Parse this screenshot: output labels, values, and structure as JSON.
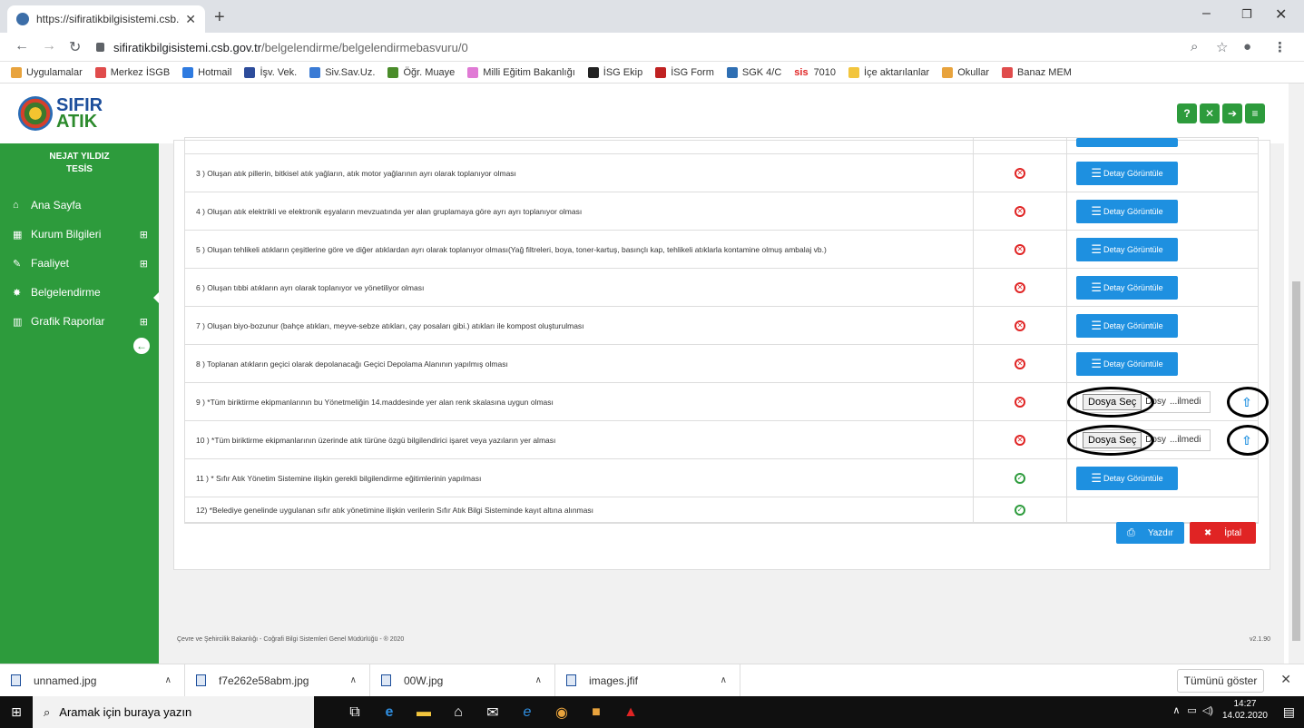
{
  "browser": {
    "tab_title": "https://sifiratikbilgisistemi.csb.go",
    "url_domain": "sifiratikbilgisistemi.csb.gov.tr",
    "url_path": "/belgelendirme/belgelendirmebasvuru/0",
    "bookmarks": [
      {
        "label": "Uygulamalar",
        "color": "#e8a33d"
      },
      {
        "label": "Merkez İSGB",
        "color": "#e04c4c"
      },
      {
        "label": "Hotmail",
        "color": "#2f7be0"
      },
      {
        "label": "İşv. Vek.",
        "color": "#2d4c9b"
      },
      {
        "label": "Siv.Sav.Uz.",
        "color": "#3a7bd5"
      },
      {
        "label": "Öğr. Muaye",
        "color": "#4a8c2a"
      },
      {
        "label": "Milli Eğitim Bakanlığı",
        "color": "#e07ad5"
      },
      {
        "label": "İSG Ekip",
        "color": "#222222"
      },
      {
        "label": "İSG Form",
        "color": "#c02222"
      },
      {
        "label": "SGK 4/C",
        "color": "#2f6fb3"
      },
      {
        "label": "7010",
        "color": "#e02424",
        "prefix": "sis"
      },
      {
        "label": "İçe aktarılanlar",
        "color": "#f2c53d"
      },
      {
        "label": "Okullar",
        "color": "#e8a33d"
      },
      {
        "label": "Banaz MEM",
        "color": "#e04c4c"
      }
    ]
  },
  "brand": {
    "line1": "SIFIR",
    "line2": "ATIK"
  },
  "sidebar": {
    "user_name": "NEJAT YILDIZ",
    "user_role": "TESİS",
    "items": [
      {
        "label": "Ana Sayfa",
        "icon": "home-icon",
        "glyph": "⌂",
        "expandable": false
      },
      {
        "label": "Kurum Bilgileri",
        "icon": "building-icon",
        "glyph": "▦",
        "expandable": true
      },
      {
        "label": "Faaliyet",
        "icon": "edit-icon",
        "glyph": "✎",
        "expandable": true
      },
      {
        "label": "Belgelendirme",
        "icon": "certificate-icon",
        "glyph": "✸",
        "expandable": false
      },
      {
        "label": "Grafik Raporlar",
        "icon": "bar-chart-icon",
        "glyph": "▥",
        "expandable": true
      }
    ]
  },
  "table": {
    "rows": [
      {
        "text": "",
        "status": "none",
        "action": "detail"
      },
      {
        "text": "3 ) Oluşan atık pillerin, bitkisel atık yağların, atık motor yağlarının ayrı olarak toplanıyor olması",
        "status": "fail",
        "action": "detail"
      },
      {
        "text": "4 ) Oluşan atık elektrikli ve elektronik eşyaların mevzuatında yer alan gruplamaya göre ayrı ayrı toplanıyor olması",
        "status": "fail",
        "action": "detail"
      },
      {
        "text": "5 ) Oluşan tehlikeli atıkların çeşitlerine göre ve diğer atıklardan ayrı olarak toplanıyor olması(Yağ filtreleri, boya, toner-kartuş, basınçlı kap, tehlikeli atıklarla kontamine olmuş ambalaj vb.)",
        "status": "fail",
        "action": "detail"
      },
      {
        "text": "6 ) Oluşan tıbbi atıkların ayrı olarak toplanıyor ve yönetiliyor olması",
        "status": "fail",
        "action": "detail"
      },
      {
        "text": "7 ) Oluşan biyo-bozunur (bahçe atıkları, meyve-sebze atıkları, çay posaları gibi.) atıkları ile kompost oluşturulması",
        "status": "fail",
        "action": "detail"
      },
      {
        "text": "8 ) Toplanan atıkların geçici olarak depolanacağı Geçici Depolama Alanının yapılmış olması",
        "status": "fail",
        "action": "detail"
      },
      {
        "text": "9 ) *Tüm biriktirme ekipmanlarının bu Yönetmeliğin 14.maddesinde yer alan renk skalasına uygun olması",
        "status": "fail",
        "action": "upload"
      },
      {
        "text": "10 ) *Tüm biriktirme ekipmanlarının üzerinde atık türüne özgü bilgilendirici işaret veya yazıların yer alması",
        "status": "fail",
        "action": "upload"
      },
      {
        "text": "11 ) * Sıfır Atık Yönetim Sistemine ilişkin gerekli bilgilendirme eğitimlerinin yapılması",
        "status": "ok",
        "action": "detail"
      },
      {
        "text": "12) *Belediye genelinde uygulanan sıfır atık yönetimine ilişkin verilerin Sıfır Atık Bilgi Sisteminde kayıt altına alınması",
        "status": "ok",
        "action": "none"
      }
    ],
    "detail_label": "Detay Görüntüle",
    "file_button": "Dosya Seç",
    "file_text_a": "Dosy",
    "file_text_b": "...ilmedi"
  },
  "actions": {
    "print": "Yazdır",
    "cancel": "İptal"
  },
  "footer": {
    "text": "Çevre ve Şehircilik Bakanlığı - Coğrafi Bilgi Sistemleri Genel Müdürlüğü - ® 2020",
    "version": "v2.1.90"
  },
  "downloads": {
    "items": [
      "unnamed.jpg",
      "f7e262e58abm.jpg",
      "00W.jpg",
      "images.jfif"
    ],
    "show_all": "Tümünü göster"
  },
  "taskbar": {
    "search_placeholder": "Aramak için buraya yazın",
    "time": "14:27",
    "date": "14.02.2020"
  },
  "colors": {
    "brand_green": "#2d9b3c",
    "primary_blue": "#1e90e0",
    "danger_red": "#e02424"
  }
}
